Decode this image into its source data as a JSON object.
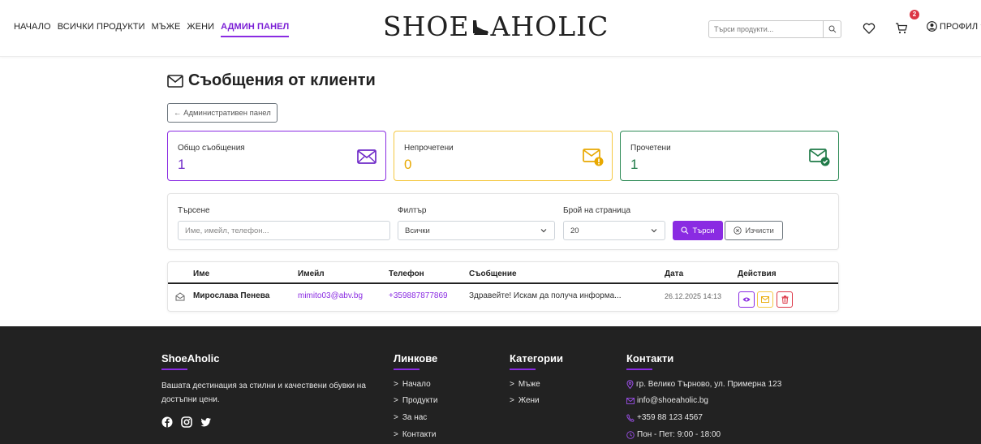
{
  "nav": {
    "links": [
      "НАЧАЛО",
      "ВСИЧКИ ПРОДУКТИ",
      "МЪЖЕ",
      "ЖЕНИ"
    ],
    "active_link": "АДМИН ПАНЕЛ",
    "logo_left": "SHOE",
    "logo_right": "AHOLIC",
    "search_placeholder": "Търси продукти...",
    "cart_count": "2",
    "profile_label": "ПРОФИЛ"
  },
  "page": {
    "title": "Съобщения от клиенти",
    "back_label": "← Административен панел"
  },
  "stats": {
    "total_label": "Общо съобщения",
    "total_value": "1",
    "unread_label": "Непрочетени",
    "unread_value": "0",
    "read_label": "Прочетени",
    "read_value": "1"
  },
  "filters": {
    "search_label": "Търсене",
    "search_placeholder": "Име, имейл, телефон...",
    "filter_label": "Филтър",
    "filter_value": "Всички",
    "per_page_label": "Брой на страница",
    "per_page_value": "20",
    "search_button": "Търси",
    "clear_button": "Изчисти"
  },
  "table": {
    "headers": [
      "Име",
      "Имейл",
      "Телефон",
      "Съобщение",
      "Дата",
      "Действия"
    ],
    "rows": [
      {
        "name": "Мирослава Пенева",
        "email": "mimito03@abv.bg",
        "phone": "+359887877869",
        "message": "Здравейте! Искам да получа информа...",
        "date": "26.12.2025 14:13"
      }
    ]
  },
  "footer": {
    "brand_title": "ShoeAholic",
    "brand_text_1": "Вашата дестинация за стилни и качествени обувки на",
    "brand_text_2": "достъпни цени.",
    "links_title": "Линкове",
    "links": [
      "Начало",
      "Продукти",
      "За нас",
      "Контакти"
    ],
    "categories_title": "Категории",
    "categories": [
      "Мъже",
      "Жени"
    ],
    "contacts_title": "Контакти",
    "address": "гр. Велико Търново, ул. Примерна 123",
    "email": "info@shoeaholic.bg",
    "phone": "+359 88 123 4567",
    "hours": "Пон - Пет: 9:00 - 18:00"
  },
  "colors": {
    "accent": "#8a2be2",
    "warning": "#f5c842",
    "success": "#2e8b57",
    "danger": "#dc3545",
    "footer_bg": "#222222"
  }
}
